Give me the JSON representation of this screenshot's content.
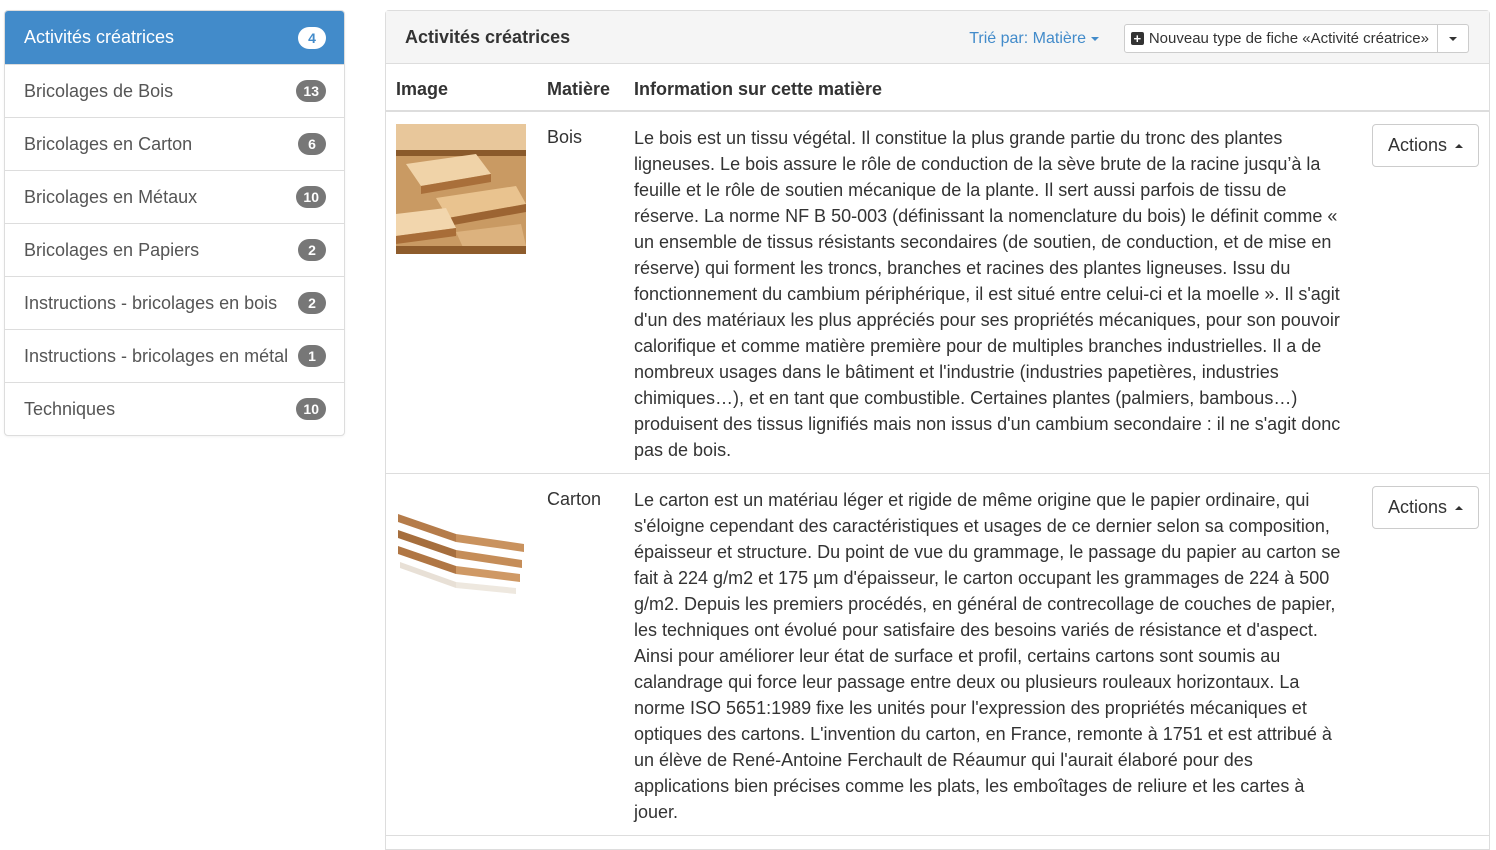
{
  "sidebar": {
    "items": [
      {
        "label": "Activités créatrices",
        "count": "4"
      },
      {
        "label": "Bricolages de Bois",
        "count": "13"
      },
      {
        "label": "Bricolages en Carton",
        "count": "6"
      },
      {
        "label": "Bricolages en Métaux",
        "count": "10"
      },
      {
        "label": "Bricolages en Papiers",
        "count": "2"
      },
      {
        "label": "Instructions - bricolages en bois",
        "count": "2"
      },
      {
        "label": "Instructions - bricolages en métal",
        "count": "1"
      },
      {
        "label": "Techniques",
        "count": "10"
      }
    ]
  },
  "panel": {
    "title": "Activités créatrices",
    "sort_label": "Trié par: Matière",
    "new_button_label": "Nouveau type de fiche «Activité créatrice»"
  },
  "table": {
    "headers": {
      "image": "Image",
      "material": "Matière",
      "info": "Information sur cette matière"
    },
    "rows": [
      {
        "material": "Bois",
        "info": "Le bois est un tissu végétal. Il constitue la plus grande partie du tronc des plantes ligneuses. Le bois assure le rôle de conduction de la sève brute de la racine jusqu’à la feuille et le rôle de soutien mécanique de la plante. Il sert aussi parfois de tissu de réserve. La norme NF B 50-003 (définissant la nomenclature du bois) le définit comme « un ensemble de tissus résistants secondaires (de soutien, de conduction, et de mise en réserve) qui forment les troncs, branches et racines des plantes ligneuses. Issu du fonctionnement du cambium périphérique, il est situé entre celui-ci et la moelle ». Il s'agit d'un des matériaux les plus appréciés pour ses propriétés mécaniques, pour son pouvoir calorifique et comme matière première pour de multiples branches industrielles. Il a de nombreux usages dans le bâtiment et l'industrie (industries papetières, industries chimiques…), et en tant que combustible. Certaines plantes (palmiers, bambous…) produisent des tissus lignifiés mais non issus d'un cambium secondaire : il ne s'agit donc pas de bois.",
        "actions_label": "Actions"
      },
      {
        "material": "Carton",
        "info": "Le carton est un matériau léger et rigide de même origine que le papier ordinaire, qui s'éloigne cependant des caractéristiques et usages de ce dernier selon sa composition, épaisseur et structure. Du point de vue du grammage, le passage du papier au carton se fait à 224 g/m2 et 175 µm d'épaisseur, le carton occupant les grammages de 224 à 500 g/m2. Depuis les premiers procédés, en général de contrecollage de couches de papier, les techniques ont évolué pour satisfaire des besoins variés de résistance et d'aspect. Ainsi pour améliorer leur état de surface et profil, certains cartons sont soumis au calandrage qui force leur passage entre deux ou plusieurs rouleaux horizontaux. La norme ISO 5651:1989 fixe les unités pour l'expression des propriétés mécaniques et optiques des cartons. L'invention du carton, en France, remonte à 1751 et est attribué à un élève de René-Antoine Ferchault de Réaumur qui l'aurait élaboré pour des applications bien précises comme les plats, les emboîtages de reliure et les cartes à jouer.",
        "actions_label": "Actions"
      }
    ]
  },
  "colors": {
    "accent": "#428bca",
    "badge": "#777777",
    "border": "#dddddd"
  }
}
